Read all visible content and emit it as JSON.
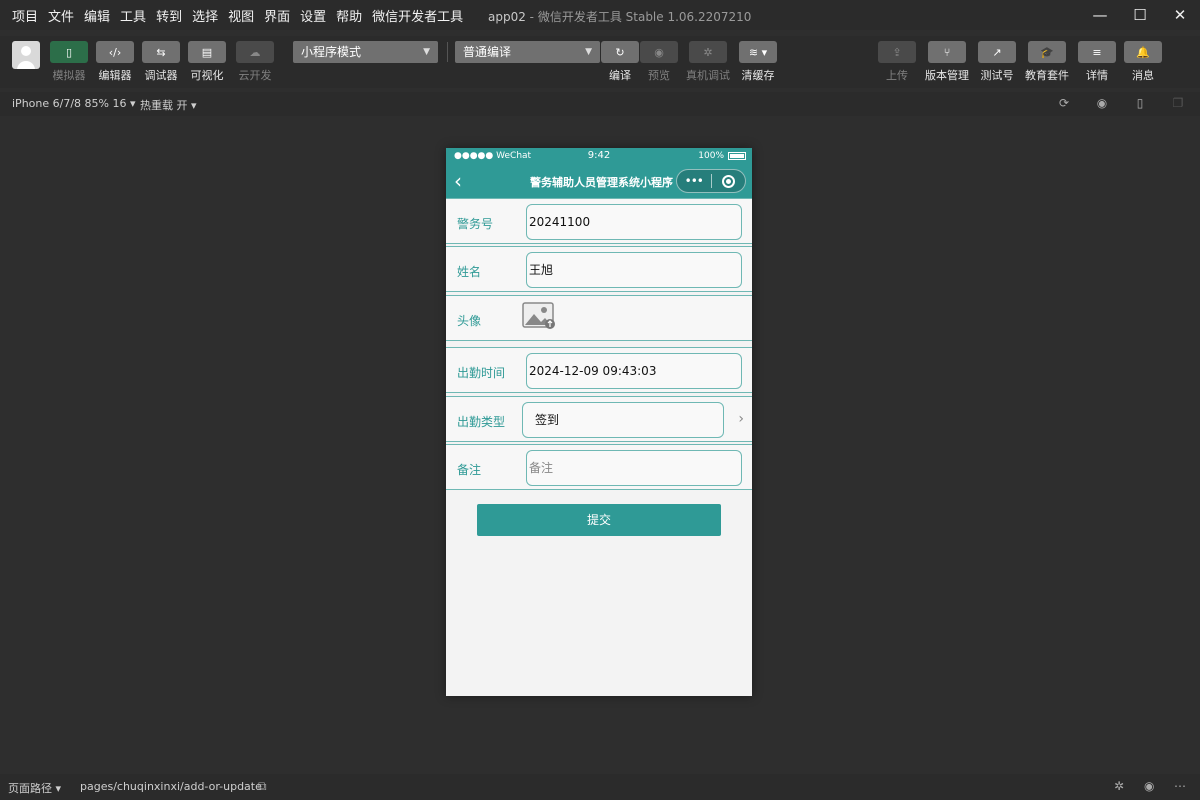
{
  "menu": [
    "项目",
    "文件",
    "编辑",
    "工具",
    "转到",
    "选择",
    "视图",
    "界面",
    "设置",
    "帮助",
    "微信开发者工具"
  ],
  "window": {
    "project": "app02",
    "title": "微信开发者工具 Stable 1.06.2207210"
  },
  "toolbar": {
    "simulator": "模拟器",
    "editor": "编辑器",
    "debugger": "调试器",
    "visualize": "可视化",
    "cloud": "云开发",
    "mode_select": "小程序模式",
    "compile_select": "普通编译",
    "compile": "编译",
    "preview": "预览",
    "remote_debug": "真机调试",
    "clear_cache": "清缓存",
    "upload": "上传",
    "version": "版本管理",
    "test": "测试号",
    "edu": "教育套件",
    "details": "详情",
    "message": "消息"
  },
  "simbar": {
    "device": "iPhone 6/7/8 85% 16 ▾",
    "hot_reload": "热重载 开 ▾"
  },
  "phone": {
    "carrier": "●●●●● WeChat",
    "time": "9:42",
    "battery": "100%",
    "nav_title": "警务辅助人员管理系统小程序",
    "capsule_dots": "•••"
  },
  "form": {
    "police_no_label": "警务号",
    "police_no_value": "20241100",
    "name_label": "姓名",
    "name_value": "王旭",
    "avatar_label": "头像",
    "attend_time_label": "出勤时间",
    "attend_time_value": "2024-12-09 09:43:03",
    "attend_type_label": "出勤类型",
    "attend_type_value": "签到",
    "remark_label": "备注",
    "remark_placeholder": "备注",
    "submit": "提交"
  },
  "bottom": {
    "page_path_label": "页面路径 ▾",
    "path": "pages/chuqinxinxi/add-or-update"
  },
  "colors": {
    "accent": "#2f9a96",
    "background": "#2e2e2e"
  }
}
